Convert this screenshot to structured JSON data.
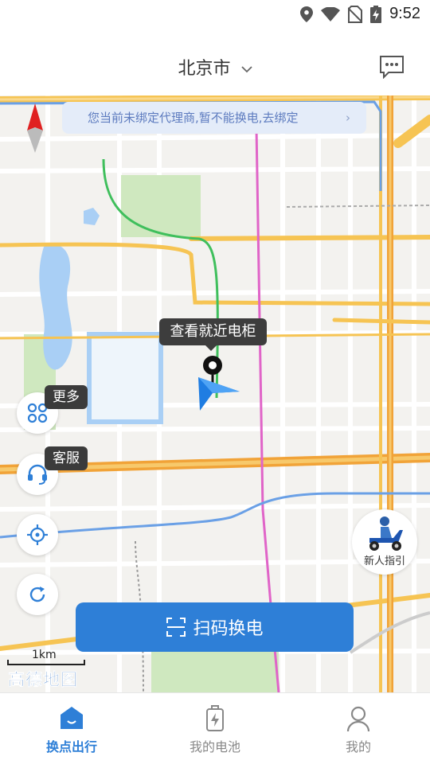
{
  "status_bar": {
    "time": "9:52"
  },
  "header": {
    "city": "北京市"
  },
  "notice": {
    "text": "您当前未绑定代理商,暂不能换电,去绑定"
  },
  "map": {
    "cabinet_tip": "查看就近电柜",
    "scale_label": "1km",
    "logo_text": "高德地图"
  },
  "float_buttons": {
    "more_tip": "更多",
    "service_tip": "客服"
  },
  "guide": {
    "label": "新人指引"
  },
  "scan_button": {
    "label": "扫码换电"
  },
  "tabs": [
    {
      "label": "换点出行",
      "icon": "home-icon"
    },
    {
      "label": "我的电池",
      "icon": "battery-icon"
    },
    {
      "label": "我的",
      "icon": "user-icon"
    }
  ],
  "colors": {
    "accent": "#2E7FD7",
    "notice_bg": "#E4ECF9",
    "road_major": "#F5C04A",
    "metro_pink": "#E064C8"
  }
}
